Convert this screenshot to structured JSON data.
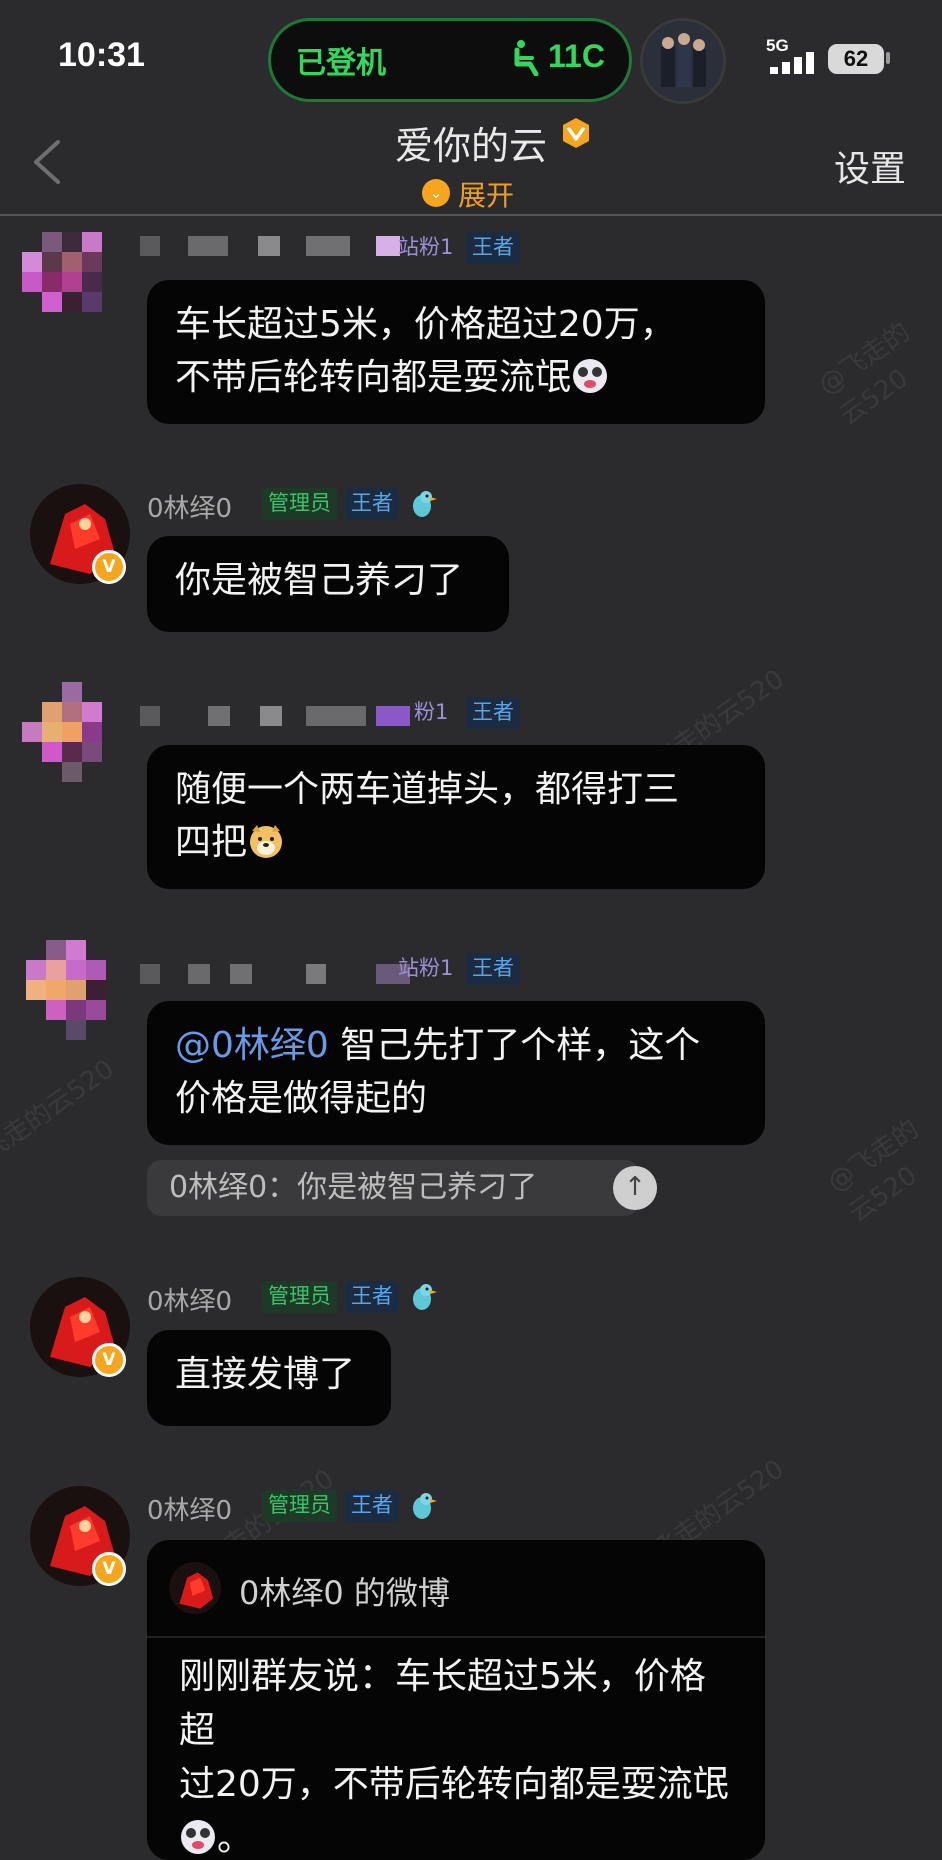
{
  "status_bar": {
    "time": "10:31",
    "island_label": "已登机",
    "seat": "11C",
    "network": "5G",
    "battery": "62"
  },
  "header": {
    "title": "爱你的云",
    "expand_label": "展开",
    "settings_label": "设置"
  },
  "colors": {
    "background": "#2b2b2d",
    "bubble": "#050505",
    "accent_orange": "#f7a51d",
    "admin_green": "#3cc46a",
    "king_blue": "#5aa5e8",
    "mention_blue": "#6a9ae6"
  },
  "messages": [
    {
      "fan_tag": "站粉1",
      "king_tag": "王者",
      "lines": [
        "车长超过5米，价格超过20万，",
        "不带后轮转向都是耍流氓"
      ]
    },
    {
      "name": "0林绎0",
      "admin_tag": "管理员",
      "king_tag": "王者",
      "text": "你是被智己养刁了"
    },
    {
      "fan_tag": "粉1",
      "king_tag": "王者",
      "lines": [
        "随便一个两车道掉头，都得打三",
        "四把"
      ]
    },
    {
      "fan_tag": "站粉1",
      "king_tag": "王者",
      "mention": "@0林绎0",
      "lines": [
        " 智己先打了个样，这个",
        "价格是做得起的"
      ],
      "quote": "0林绎0：你是被智己养刁了"
    },
    {
      "name": "0林绎0",
      "admin_tag": "管理员",
      "king_tag": "王者",
      "text": "直接发博了"
    },
    {
      "name": "0林绎0",
      "admin_tag": "管理员",
      "king_tag": "王者",
      "card_title": "0林绎0 的微博",
      "card_lines": [
        "刚刚群友说：车长超过5米，价格超",
        "过20万，不带后轮转向都是耍流氓",
        "。"
      ]
    }
  ],
  "watermarks": [
    "@飞走的云520",
    "飞走的云520",
    "飞走的云520",
    "@飞走的云520",
    "飞走的云520",
    "飞走的云520"
  ]
}
